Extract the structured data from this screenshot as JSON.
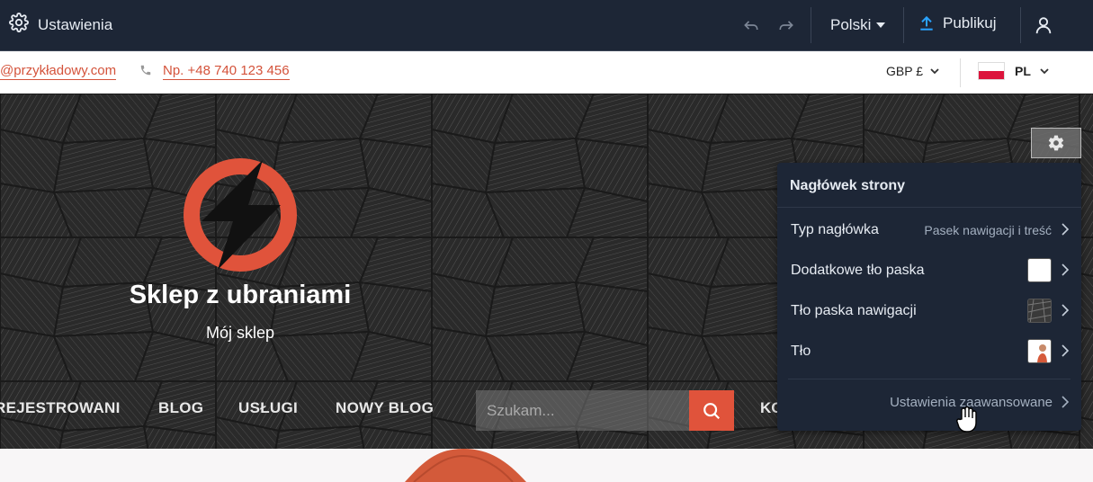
{
  "topbar": {
    "settings_label": "Ustawienia",
    "language": "Polski",
    "publish_label": "Publikuj"
  },
  "contact": {
    "email": "@przykładowy.com",
    "phone": "Np. +48 740 123 456",
    "currency": "GBP £",
    "locale": "PL"
  },
  "store": {
    "title": "Sklep z ubraniami",
    "subtitle": "Mój sklep"
  },
  "nav": {
    "items": [
      "REJESTROWANI",
      "BLOG",
      "USŁUGI",
      "NOWY BLOG"
    ],
    "partial": "KO"
  },
  "search": {
    "placeholder": "Szukam..."
  },
  "panel": {
    "title": "Nagłówek strony",
    "rows": [
      {
        "label": "Typ nagłówka",
        "value": "Pasek nawigacji i treść"
      },
      {
        "label": "Dodatkowe tło paska"
      },
      {
        "label": "Tło paska nawigacji"
      },
      {
        "label": "Tło"
      }
    ],
    "advanced_label": "Ustawienia zaawansowane"
  },
  "colors": {
    "editor_bg": "#1d2636",
    "accent": "#e0533b",
    "link": "#d4533b",
    "publish_icon": "#2aa3ff"
  },
  "icons": [
    "gear-icon",
    "undo-icon",
    "redo-icon",
    "caret-down-icon",
    "upload-icon",
    "user-icon",
    "phone-icon",
    "search-icon",
    "chevron-right-icon",
    "lightning-logo",
    "hand-cursor-icon"
  ]
}
